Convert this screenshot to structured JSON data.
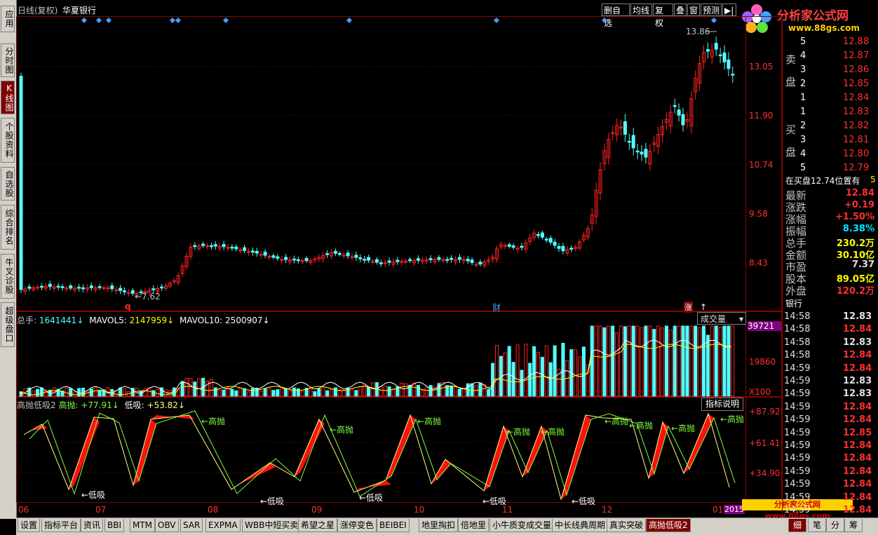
{
  "left_nav": [
    {
      "label": "应用",
      "top": 8,
      "h": 38
    },
    {
      "label": "分时图",
      "top": 62,
      "h": 48
    },
    {
      "label": "K线图",
      "top": 115,
      "h": 48,
      "active": true
    },
    {
      "label": "个股资料",
      "top": 168,
      "h": 64
    },
    {
      "label": "自选股",
      "top": 238,
      "h": 48
    },
    {
      "label": "综合排名",
      "top": 292,
      "h": 64
    },
    {
      "label": "牛叉诊股",
      "top": 362,
      "h": 64
    },
    {
      "label": "超级盘口",
      "top": 431,
      "h": 64
    }
  ],
  "header": {
    "period": "日线(复权)",
    "stock": "华夏银行",
    "buttons": [
      "删自选",
      "均线",
      "复权",
      "叠",
      "窗",
      "预测",
      "▶|"
    ]
  },
  "logo": {
    "title": "分析家公式网",
    "url": "www.88gs.com"
  },
  "main_chart": {
    "high_label": "13.86",
    "low_label": "←7.62",
    "marker_q": "q",
    "marker_cai": "财",
    "marker_zhang": "涨",
    "y_ticks": [
      "13.05",
      "11.90",
      "10.74",
      "9.58",
      "8.43"
    ]
  },
  "volume": {
    "label_total": "总手:",
    "total": "1641441↓",
    "label_ma5": "MAVOL5:",
    "ma5": "2147959↓",
    "label_ma10": "MAVOL10:",
    "ma10": "2500907↓",
    "select_value": "成交量",
    "y_ticks": [
      "39721",
      "19860"
    ],
    "unit": "X100"
  },
  "indicator": {
    "name": "高抛低吸2",
    "label_high": "高抛:",
    "high": "+77.91↓",
    "label_low": "低吸:",
    "low": "+53.82↓",
    "help_button": "指标说明",
    "y_ticks": [
      "+87.92",
      "+61.41",
      "+34.90"
    ],
    "sell_signal": "高抛",
    "buy_signal": "低吸"
  },
  "x_axis": [
    "06",
    "07",
    "08",
    "09",
    "10",
    "11",
    "12",
    "01"
  ],
  "x_axis_year": "2015",
  "order_book": {
    "sell_label": [
      "卖",
      "盘"
    ],
    "buy_label": [
      "买",
      "盘"
    ],
    "sells": [
      {
        "lvl": "5",
        "price": "12.88"
      },
      {
        "lvl": "4",
        "price": "12.87"
      },
      {
        "lvl": "3",
        "price": "12.86"
      },
      {
        "lvl": "2",
        "price": "12.85"
      },
      {
        "lvl": "1",
        "price": "12.84"
      }
    ],
    "buys": [
      {
        "lvl": "1",
        "price": "12.83"
      },
      {
        "lvl": "2",
        "price": "12.82"
      },
      {
        "lvl": "3",
        "price": "12.81"
      },
      {
        "lvl": "4",
        "price": "12.80"
      },
      {
        "lvl": "5",
        "price": "12.79"
      }
    ],
    "status": "在买盘12.74位置有",
    "status_num": "5"
  },
  "quote": [
    {
      "k": "最新",
      "v": "12.84",
      "c": "#ff3030"
    },
    {
      "k": "涨跌",
      "v": "+0.19",
      "c": "#ff3030"
    },
    {
      "k": "涨幅",
      "v": "+1.50%",
      "c": "#ff3030"
    },
    {
      "k": "振幅",
      "v": "8.38%",
      "c": "#00e5ff"
    },
    {
      "k": "总手",
      "v": "230.2万",
      "c": "#ffff00"
    },
    {
      "k": "金额",
      "v": "30.10亿",
      "c": "#ffff00"
    },
    {
      "k": "市盈",
      "v": "7.37",
      "c": "#e0e0e0"
    },
    {
      "k": "股本",
      "v": "89.05亿",
      "c": "#ffff00"
    },
    {
      "k": "外盘",
      "v": "120.2万",
      "c": "#ff3030"
    }
  ],
  "trades_title": "银行",
  "trades": [
    {
      "t": "14:58",
      "p": "12.83"
    },
    {
      "t": "14:58",
      "p": "12.84"
    },
    {
      "t": "14:58",
      "p": "12.83"
    },
    {
      "t": "14:58",
      "p": "12.84"
    },
    {
      "t": "14:59",
      "p": "12.84"
    },
    {
      "t": "14:59",
      "p": "12.83"
    },
    {
      "t": "14:59",
      "p": "12.83"
    },
    {
      "t": "14:59",
      "p": "12.84"
    },
    {
      "t": "14:59",
      "p": "12.84"
    },
    {
      "t": "14:59",
      "p": "12.85"
    },
    {
      "t": "14:59",
      "p": "12.84"
    },
    {
      "t": "14:59",
      "p": "12.84"
    },
    {
      "t": "14:59",
      "p": "12.84"
    },
    {
      "t": "14:59",
      "p": "12.84"
    },
    {
      "t": "14:59",
      "p": "12.84"
    },
    {
      "t": "14:59",
      "p": "12.84"
    }
  ],
  "footer_ad": "分析家公式网 www.88gs.com",
  "bottom_tabs": [
    "设置",
    "指标平台",
    "资讯",
    "BBI",
    "MTM",
    "OBV",
    "SAR",
    "EXPMA",
    "WBB中短买卖",
    "希望之星",
    "涨停变色",
    "BEIBEI",
    "地里掏扣",
    "倍地里",
    "小牛质变成交量",
    "中长线典周期",
    "真实突破",
    "高抛低吸2"
  ],
  "bottom_tabs_active": "高抛低吸2",
  "bottom_right_tabs": [
    "细",
    "笔",
    "分",
    "筹"
  ],
  "colors": {
    "up": "#ff2020",
    "down": "#54ffff",
    "grid": "#8b0000",
    "ma5": "#ffffff",
    "ma10": "#ffff00",
    "indicator_line": "#ffff80",
    "indicator_line2": "#80ff40"
  }
}
